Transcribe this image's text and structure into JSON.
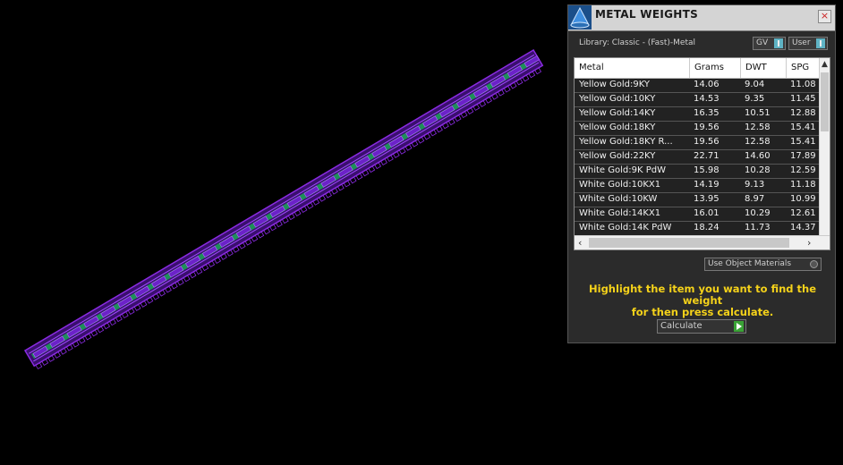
{
  "panel": {
    "title": "METAL WEIGHTS",
    "close_label": "×",
    "library_label": "Library: Classic - (Fast)-Metal",
    "toggle_gv": "GV",
    "toggle_user": "User",
    "use_object_materials": "Use Object Materials",
    "hint_line1": "Highlight the item you want to find the weight",
    "hint_line2": "for then press calculate.",
    "calculate_label": "Calculate"
  },
  "table": {
    "columns": [
      "Metal",
      "Grams",
      "DWT",
      "SPG"
    ],
    "rows": [
      [
        "Yellow Gold:9KY",
        "14.06",
        "9.04",
        "11.08"
      ],
      [
        "Yellow Gold:10KY",
        "14.53",
        "9.35",
        "11.45"
      ],
      [
        "Yellow Gold:14KY",
        "16.35",
        "10.51",
        "12.88"
      ],
      [
        "Yellow Gold:18KY",
        "19.56",
        "12.58",
        "15.41"
      ],
      [
        "Yellow Gold:18KY R...",
        "19.56",
        "12.58",
        "15.41"
      ],
      [
        "Yellow Gold:22KY",
        "22.71",
        "14.60",
        "17.89"
      ],
      [
        "White Gold:9K PdW",
        "15.98",
        "10.28",
        "12.59"
      ],
      [
        "White Gold:10KX1",
        "14.19",
        "9.13",
        "11.18"
      ],
      [
        "White Gold:10KW",
        "13.95",
        "8.97",
        "10.99"
      ],
      [
        "White Gold:14KX1",
        "16.01",
        "10.29",
        "12.61"
      ],
      [
        "White Gold:14K PdW",
        "18.24",
        "11.73",
        "14.37"
      ]
    ]
  },
  "colors": {
    "model_purple": "#7a1fd0",
    "model_green": "#1e8f5a",
    "hint_yellow": "#f5d21a",
    "toggle_cyan": "#5fb3c4",
    "calc_green": "#3aa336"
  },
  "icons": {
    "logo": "cone-logo-icon",
    "close": "close-icon",
    "play": "play-icon"
  }
}
